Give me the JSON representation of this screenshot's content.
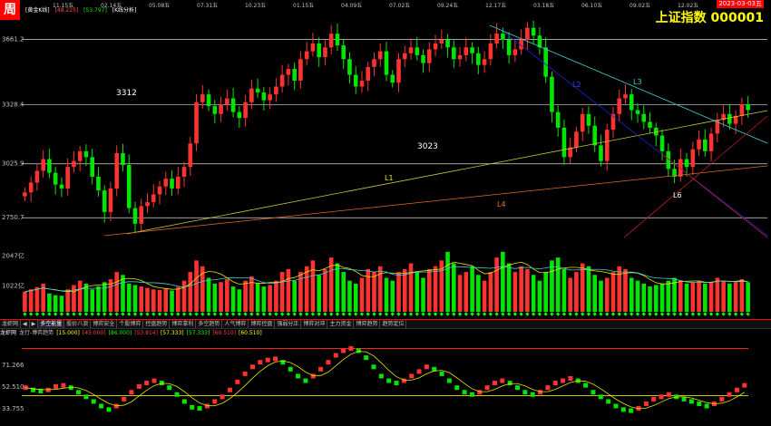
{
  "logo": "周",
  "header": {
    "indicator_name": "[黄金K线]",
    "v1": "[48.225]",
    "v2": "[53.797]",
    "mode": "[K线分析]"
  },
  "top_dates": [
    "11.15五",
    "02.14五",
    "05.08五",
    "07.31五",
    "10.23五",
    "01.15五",
    "04.09五",
    "07.02五",
    "09.24五",
    "12.17五",
    "03.18五",
    "06.10五",
    "09.02五",
    "12.02五"
  ],
  "title": "上证指数  000001",
  "date_badge": "2023-03-03五",
  "y_ticks_price": [
    {
      "label": "3661.2",
      "value": 3661.2
    },
    {
      "label": "3328.4",
      "value": 3328.4
    },
    {
      "label": "3025.9",
      "value": 3025.9
    },
    {
      "label": "2750.7",
      "value": 2750.7
    }
  ],
  "y_ticks_volume": [
    {
      "label": "2047亿",
      "value": 2047
    },
    {
      "label": "1022亿",
      "value": 1022
    }
  ],
  "y_ticks_indicator": [
    {
      "label": "71.266",
      "value": 71.266
    },
    {
      "label": "52.510",
      "value": 52.51
    },
    {
      "label": "33.755",
      "value": 33.755
    }
  ],
  "annotations": {
    "level_3312": "3312",
    "level_3023": "3023",
    "L1": "L1",
    "L2": "L2",
    "L3": "L3",
    "L4": "L4",
    "L6": "L6"
  },
  "tabs": [
    "龙虾网",
    "◀",
    "▶",
    "多空能量",
    "股价八浪",
    "博弈安全",
    "个股博弈",
    "控盘趋势",
    "博弈拿利",
    "多空趋势",
    "人气博弈",
    "博弈控盘",
    "强弱分正",
    "博弈对冲",
    "主力资金",
    "博弈趋势",
    "趋势定位"
  ],
  "indicator_header": {
    "name": "龙虾网",
    "sub": "龙行-博弈趋势",
    "values": [
      "15.000",
      "45.000",
      "86.000",
      "53.814",
      "57.333",
      "57.333",
      "60.510",
      "60.510"
    ]
  },
  "colors": {
    "up": "#ff3232",
    "down": "#00e600",
    "grid": "#cfcfcf",
    "cyan": "#45d0d0",
    "yellow": "#e6e600"
  },
  "chart_data": [
    {
      "type": "candlestick",
      "title": "上证指数 000001",
      "ylim": [
        2650,
        3760
      ],
      "period": "weekly",
      "x_labels": [
        "11.15五",
        "02.14五",
        "05.08五",
        "07.31五",
        "10.23五",
        "01.15五",
        "04.09五",
        "07.02五",
        "09.24五",
        "12.17五",
        "03.18五",
        "06.10五",
        "09.02五",
        "12.02五"
      ],
      "closes": [
        2880,
        2930,
        2990,
        3050,
        2980,
        2920,
        2900,
        3010,
        3040,
        3090,
        3060,
        2960,
        2890,
        2780,
        2900,
        3080,
        3020,
        2800,
        2720,
        2810,
        2830,
        2870,
        2910,
        2950,
        2900,
        2960,
        3010,
        3130,
        3340,
        3380,
        3320,
        3280,
        3330,
        3360,
        3290,
        3260,
        3340,
        3410,
        3390,
        3350,
        3380,
        3420,
        3480,
        3510,
        3450,
        3560,
        3600,
        3640,
        3570,
        3620,
        3690,
        3630,
        3560,
        3480,
        3420,
        3450,
        3520,
        3560,
        3600,
        3480,
        3440,
        3560,
        3590,
        3620,
        3580,
        3540,
        3610,
        3640,
        3660,
        3620,
        3560,
        3580,
        3620,
        3590,
        3530,
        3560,
        3640,
        3690,
        3660,
        3580,
        3610,
        3660,
        3720,
        3680,
        3620,
        3470,
        3290,
        3210,
        3060,
        3110,
        3190,
        3280,
        3220,
        3120,
        3040,
        3200,
        3280,
        3360,
        3380,
        3300,
        3280,
        3240,
        3210,
        3170,
        3090,
        3000,
        2960,
        3050,
        3010,
        3100,
        3150,
        3090,
        3180,
        3250,
        3280,
        3230,
        3270,
        3330,
        3300
      ],
      "annotations": [
        "3312",
        "3023",
        "L1",
        "L2",
        "L3",
        "L4",
        "L6"
      ]
    },
    {
      "type": "bar",
      "title": "volume",
      "unit": "亿",
      "ylim": [
        0,
        2600
      ],
      "values": [
        820,
        900,
        980,
        1100,
        760,
        700,
        680,
        900,
        1050,
        1200,
        1100,
        900,
        1000,
        1150,
        1250,
        1500,
        1400,
        1100,
        1050,
        1000,
        950,
        900,
        880,
        920,
        860,
        980,
        1200,
        1500,
        1900,
        1700,
        1300,
        1100,
        1150,
        1250,
        1000,
        900,
        1200,
        1350,
        1100,
        1000,
        1050,
        1200,
        1500,
        1600,
        1200,
        1500,
        1700,
        1900,
        1400,
        1600,
        2000,
        1800,
        1500,
        1200,
        1100,
        1300,
        1600,
        1500,
        1700,
        1300,
        1200,
        1500,
        1600,
        1800,
        1500,
        1300,
        1600,
        1700,
        1900,
        2200,
        1800,
        1400,
        1500,
        1700,
        1400,
        1200,
        1500,
        2000,
        2200,
        1800,
        1500,
        1700,
        1600,
        1400,
        1200,
        1500,
        1900,
        2000,
        1600,
        1300,
        1500,
        1800,
        1700,
        1400,
        1200,
        1300,
        1500,
        1700,
        1600,
        1300,
        1200,
        1100,
        1000,
        1050,
        1100,
        1200,
        1300,
        1200,
        1100,
        1150,
        1200,
        1100,
        1150,
        1300,
        1200,
        1100,
        1150,
        1250,
        1150
      ]
    },
    {
      "type": "line",
      "title": "龙行-博弈趋势",
      "ylim": [
        25,
        95
      ],
      "series": [
        {
          "name": "",
          "values": [
            52,
            50,
            49,
            50,
            53,
            54,
            52,
            48,
            44,
            40,
            36,
            33,
            36,
            42,
            48,
            53,
            56,
            58,
            56,
            52,
            46,
            40,
            35,
            34,
            36,
            40,
            44,
            50,
            57,
            64,
            70,
            74,
            76,
            77,
            74,
            68,
            62,
            58,
            62,
            68,
            74,
            80,
            84,
            86,
            84,
            78,
            70,
            62,
            58,
            56,
            58,
            62,
            66,
            70,
            68,
            64,
            58,
            52,
            48,
            46,
            48,
            52,
            56,
            58,
            56,
            52,
            48,
            46,
            48,
            52,
            56,
            58,
            60,
            58,
            54,
            48,
            44,
            40,
            36,
            33,
            32,
            34,
            38,
            42,
            44,
            46,
            44,
            42,
            40,
            38,
            36,
            38,
            42,
            46,
            50,
            54
          ]
        }
      ]
    }
  ]
}
